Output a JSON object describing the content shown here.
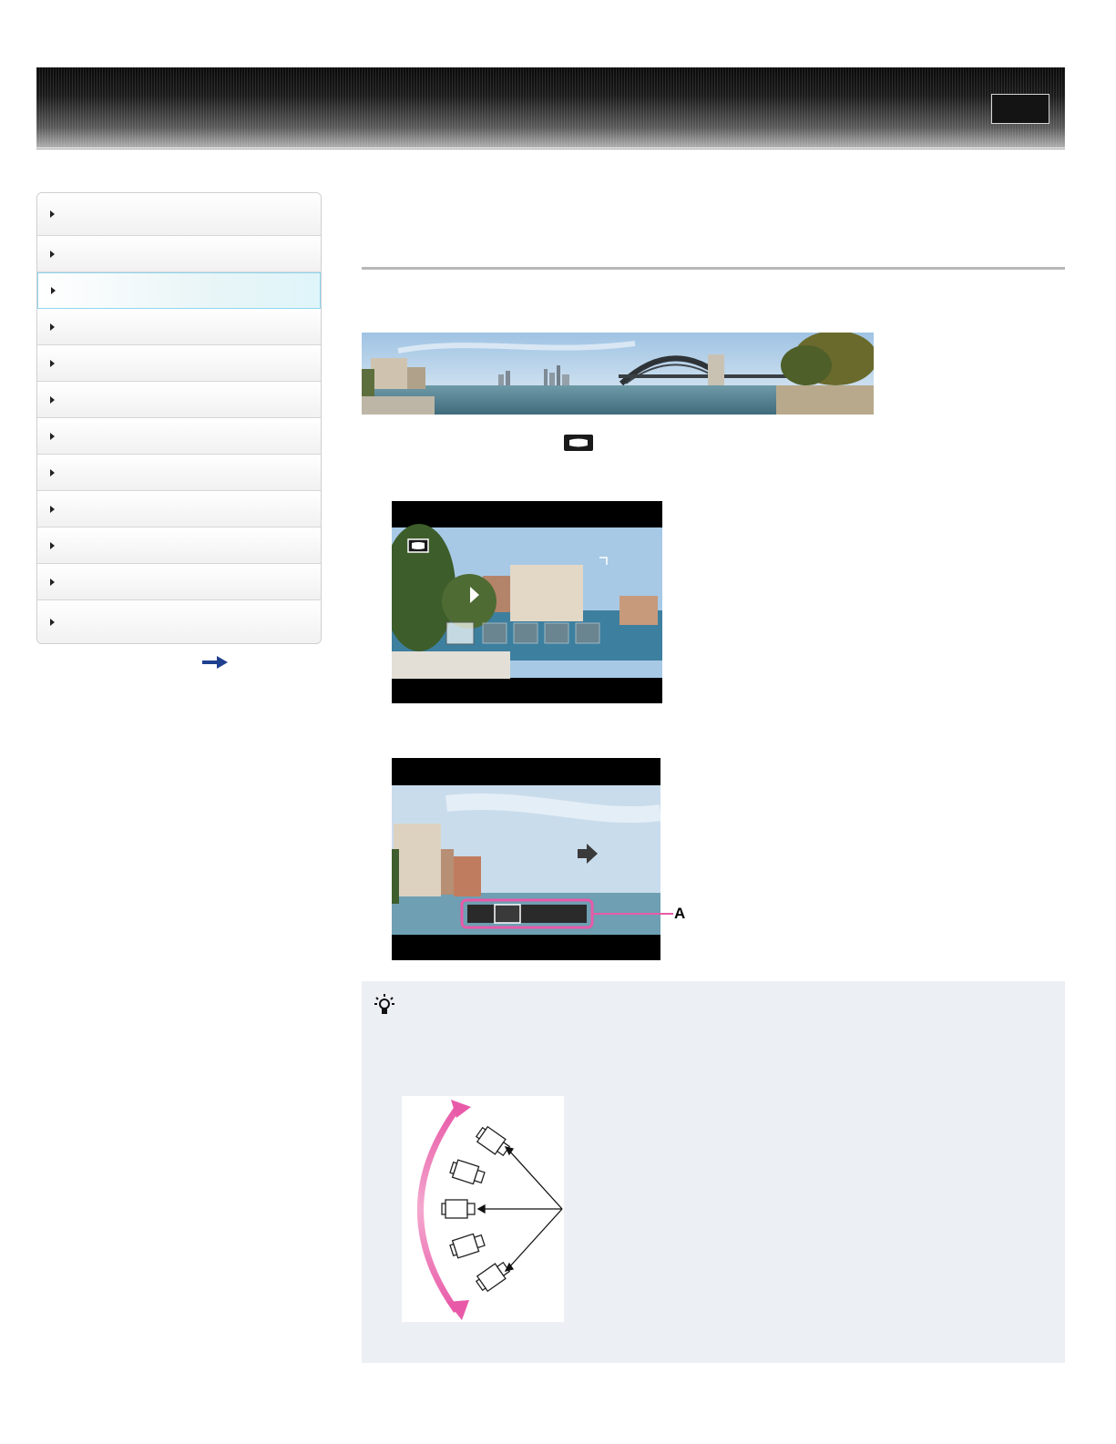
{
  "header": {
    "button_label": ""
  },
  "sidebar": {
    "items": [
      {
        "label": "",
        "active": false
      },
      {
        "label": "",
        "active": false
      },
      {
        "label": "",
        "active": true
      },
      {
        "label": "",
        "active": false
      },
      {
        "label": "",
        "active": false
      },
      {
        "label": "",
        "active": false
      },
      {
        "label": "",
        "active": false
      },
      {
        "label": "",
        "active": false
      },
      {
        "label": "",
        "active": false
      },
      {
        "label": "",
        "active": false
      },
      {
        "label": "",
        "active": false
      },
      {
        "label": "",
        "active": false
      }
    ],
    "more_icon": "arrow-right-icon"
  },
  "main": {
    "mode_icon": "sweep-panorama-icon",
    "callout_label": "A"
  },
  "tip": {
    "icon": "lightbulb-icon"
  },
  "colors": {
    "accent_pink": "#e85aa8",
    "active_border": "#8fd6ee",
    "tip_background": "#eceff4"
  }
}
